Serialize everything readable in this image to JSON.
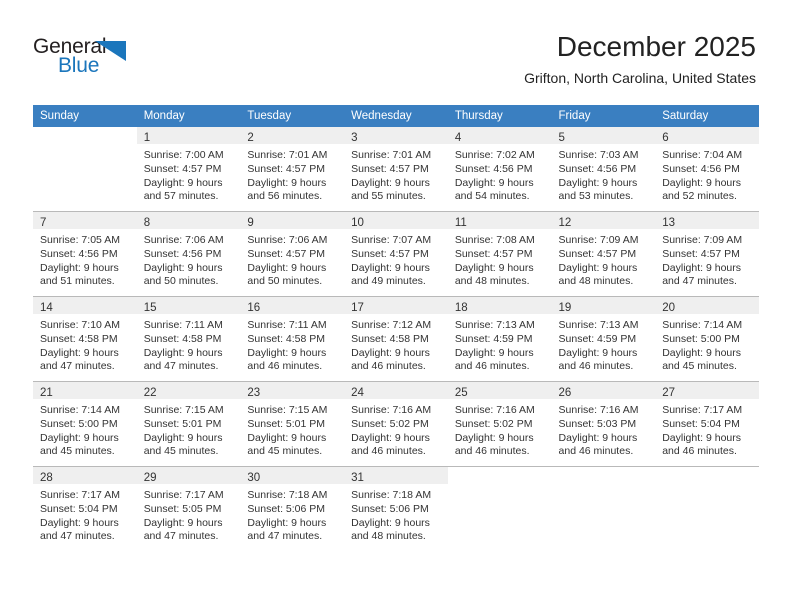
{
  "brand": {
    "word_general": "General",
    "word_blue": "Blue",
    "accent_color": "#1b76bc"
  },
  "header": {
    "title": "December 2025",
    "location": "Grifton, North Carolina, United States",
    "header_row_color": "#3a7fc1",
    "daynum_band_color": "#efefef"
  },
  "weekday_headers": [
    "Sunday",
    "Monday",
    "Tuesday",
    "Wednesday",
    "Thursday",
    "Friday",
    "Saturday"
  ],
  "weeks": [
    [
      {
        "day": "",
        "lines": []
      },
      {
        "day": "1",
        "lines": [
          "Sunrise: 7:00 AM",
          "Sunset: 4:57 PM",
          "Daylight: 9 hours",
          "and 57 minutes."
        ]
      },
      {
        "day": "2",
        "lines": [
          "Sunrise: 7:01 AM",
          "Sunset: 4:57 PM",
          "Daylight: 9 hours",
          "and 56 minutes."
        ]
      },
      {
        "day": "3",
        "lines": [
          "Sunrise: 7:01 AM",
          "Sunset: 4:57 PM",
          "Daylight: 9 hours",
          "and 55 minutes."
        ]
      },
      {
        "day": "4",
        "lines": [
          "Sunrise: 7:02 AM",
          "Sunset: 4:56 PM",
          "Daylight: 9 hours",
          "and 54 minutes."
        ]
      },
      {
        "day": "5",
        "lines": [
          "Sunrise: 7:03 AM",
          "Sunset: 4:56 PM",
          "Daylight: 9 hours",
          "and 53 minutes."
        ]
      },
      {
        "day": "6",
        "lines": [
          "Sunrise: 7:04 AM",
          "Sunset: 4:56 PM",
          "Daylight: 9 hours",
          "and 52 minutes."
        ]
      }
    ],
    [
      {
        "day": "7",
        "lines": [
          "Sunrise: 7:05 AM",
          "Sunset: 4:56 PM",
          "Daylight: 9 hours",
          "and 51 minutes."
        ]
      },
      {
        "day": "8",
        "lines": [
          "Sunrise: 7:06 AM",
          "Sunset: 4:56 PM",
          "Daylight: 9 hours",
          "and 50 minutes."
        ]
      },
      {
        "day": "9",
        "lines": [
          "Sunrise: 7:06 AM",
          "Sunset: 4:57 PM",
          "Daylight: 9 hours",
          "and 50 minutes."
        ]
      },
      {
        "day": "10",
        "lines": [
          "Sunrise: 7:07 AM",
          "Sunset: 4:57 PM",
          "Daylight: 9 hours",
          "and 49 minutes."
        ]
      },
      {
        "day": "11",
        "lines": [
          "Sunrise: 7:08 AM",
          "Sunset: 4:57 PM",
          "Daylight: 9 hours",
          "and 48 minutes."
        ]
      },
      {
        "day": "12",
        "lines": [
          "Sunrise: 7:09 AM",
          "Sunset: 4:57 PM",
          "Daylight: 9 hours",
          "and 48 minutes."
        ]
      },
      {
        "day": "13",
        "lines": [
          "Sunrise: 7:09 AM",
          "Sunset: 4:57 PM",
          "Daylight: 9 hours",
          "and 47 minutes."
        ]
      }
    ],
    [
      {
        "day": "14",
        "lines": [
          "Sunrise: 7:10 AM",
          "Sunset: 4:58 PM",
          "Daylight: 9 hours",
          "and 47 minutes."
        ]
      },
      {
        "day": "15",
        "lines": [
          "Sunrise: 7:11 AM",
          "Sunset: 4:58 PM",
          "Daylight: 9 hours",
          "and 47 minutes."
        ]
      },
      {
        "day": "16",
        "lines": [
          "Sunrise: 7:11 AM",
          "Sunset: 4:58 PM",
          "Daylight: 9 hours",
          "and 46 minutes."
        ]
      },
      {
        "day": "17",
        "lines": [
          "Sunrise: 7:12 AM",
          "Sunset: 4:58 PM",
          "Daylight: 9 hours",
          "and 46 minutes."
        ]
      },
      {
        "day": "18",
        "lines": [
          "Sunrise: 7:13 AM",
          "Sunset: 4:59 PM",
          "Daylight: 9 hours",
          "and 46 minutes."
        ]
      },
      {
        "day": "19",
        "lines": [
          "Sunrise: 7:13 AM",
          "Sunset: 4:59 PM",
          "Daylight: 9 hours",
          "and 46 minutes."
        ]
      },
      {
        "day": "20",
        "lines": [
          "Sunrise: 7:14 AM",
          "Sunset: 5:00 PM",
          "Daylight: 9 hours",
          "and 45 minutes."
        ]
      }
    ],
    [
      {
        "day": "21",
        "lines": [
          "Sunrise: 7:14 AM",
          "Sunset: 5:00 PM",
          "Daylight: 9 hours",
          "and 45 minutes."
        ]
      },
      {
        "day": "22",
        "lines": [
          "Sunrise: 7:15 AM",
          "Sunset: 5:01 PM",
          "Daylight: 9 hours",
          "and 45 minutes."
        ]
      },
      {
        "day": "23",
        "lines": [
          "Sunrise: 7:15 AM",
          "Sunset: 5:01 PM",
          "Daylight: 9 hours",
          "and 45 minutes."
        ]
      },
      {
        "day": "24",
        "lines": [
          "Sunrise: 7:16 AM",
          "Sunset: 5:02 PM",
          "Daylight: 9 hours",
          "and 46 minutes."
        ]
      },
      {
        "day": "25",
        "lines": [
          "Sunrise: 7:16 AM",
          "Sunset: 5:02 PM",
          "Daylight: 9 hours",
          "and 46 minutes."
        ]
      },
      {
        "day": "26",
        "lines": [
          "Sunrise: 7:16 AM",
          "Sunset: 5:03 PM",
          "Daylight: 9 hours",
          "and 46 minutes."
        ]
      },
      {
        "day": "27",
        "lines": [
          "Sunrise: 7:17 AM",
          "Sunset: 5:04 PM",
          "Daylight: 9 hours",
          "and 46 minutes."
        ]
      }
    ],
    [
      {
        "day": "28",
        "lines": [
          "Sunrise: 7:17 AM",
          "Sunset: 5:04 PM",
          "Daylight: 9 hours",
          "and 47 minutes."
        ]
      },
      {
        "day": "29",
        "lines": [
          "Sunrise: 7:17 AM",
          "Sunset: 5:05 PM",
          "Daylight: 9 hours",
          "and 47 minutes."
        ]
      },
      {
        "day": "30",
        "lines": [
          "Sunrise: 7:18 AM",
          "Sunset: 5:06 PM",
          "Daylight: 9 hours",
          "and 47 minutes."
        ]
      },
      {
        "day": "31",
        "lines": [
          "Sunrise: 7:18 AM",
          "Sunset: 5:06 PM",
          "Daylight: 9 hours",
          "and 48 minutes."
        ]
      },
      {
        "day": "",
        "lines": []
      },
      {
        "day": "",
        "lines": []
      },
      {
        "day": "",
        "lines": []
      }
    ]
  ]
}
